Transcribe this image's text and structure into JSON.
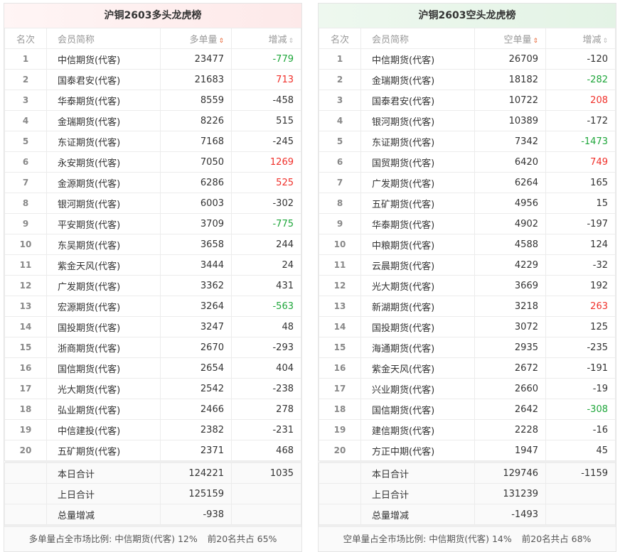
{
  "panels": [
    {
      "key": "long",
      "title": "沪铜2603多头龙虎榜",
      "headers": {
        "rank": "名次",
        "name": "会员简称",
        "volume": "多单量",
        "change": "增减"
      },
      "rows": [
        [
          "1",
          "中信期货(代客)",
          "23477",
          "-779",
          "green"
        ],
        [
          "2",
          "国泰君安(代客)",
          "21683",
          "713",
          "red"
        ],
        [
          "3",
          "华泰期货(代客)",
          "8559",
          "-458",
          ""
        ],
        [
          "4",
          "金瑞期货(代客)",
          "8226",
          "515",
          ""
        ],
        [
          "5",
          "东证期货(代客)",
          "7168",
          "-245",
          ""
        ],
        [
          "6",
          "永安期货(代客)",
          "7050",
          "1269",
          "red"
        ],
        [
          "7",
          "金源期货(代客)",
          "6286",
          "525",
          "red"
        ],
        [
          "8",
          "银河期货(代客)",
          "6003",
          "-302",
          ""
        ],
        [
          "9",
          "平安期货(代客)",
          "3709",
          "-775",
          "green"
        ],
        [
          "10",
          "东吴期货(代客)",
          "3658",
          "244",
          ""
        ],
        [
          "11",
          "紫金天风(代客)",
          "3444",
          "24",
          ""
        ],
        [
          "12",
          "广发期货(代客)",
          "3362",
          "431",
          ""
        ],
        [
          "13",
          "宏源期货(代客)",
          "3264",
          "-563",
          "green"
        ],
        [
          "14",
          "国投期货(代客)",
          "3247",
          "48",
          ""
        ],
        [
          "15",
          "浙商期货(代客)",
          "2670",
          "-293",
          ""
        ],
        [
          "16",
          "国信期货(代客)",
          "2654",
          "404",
          ""
        ],
        [
          "17",
          "光大期货(代客)",
          "2542",
          "-238",
          ""
        ],
        [
          "18",
          "弘业期货(代客)",
          "2466",
          "278",
          ""
        ],
        [
          "19",
          "中信建投(代客)",
          "2382",
          "-231",
          ""
        ],
        [
          "20",
          "五矿期货(代客)",
          "2371",
          "468",
          ""
        ]
      ],
      "totals": [
        [
          "本日合计",
          "124221",
          "1035"
        ],
        [
          "上日合计",
          "125159",
          ""
        ],
        [
          "总量增减",
          "-938",
          ""
        ]
      ],
      "footer": {
        "ratio": "多单量占全市场比例: 中信期货(代客) 12%",
        "top20": "前20名共占 65%"
      }
    },
    {
      "key": "short",
      "title": "沪铜2603空头龙虎榜",
      "headers": {
        "rank": "名次",
        "name": "会员简称",
        "volume": "空单量",
        "change": "增减"
      },
      "rows": [
        [
          "1",
          "中信期货(代客)",
          "26709",
          "-120",
          ""
        ],
        [
          "2",
          "金瑞期货(代客)",
          "18182",
          "-282",
          "green"
        ],
        [
          "3",
          "国泰君安(代客)",
          "10722",
          "208",
          "red"
        ],
        [
          "4",
          "银河期货(代客)",
          "10389",
          "-172",
          ""
        ],
        [
          "5",
          "东证期货(代客)",
          "7342",
          "-1473",
          "green"
        ],
        [
          "6",
          "国贸期货(代客)",
          "6420",
          "749",
          "red"
        ],
        [
          "7",
          "广发期货(代客)",
          "6264",
          "165",
          ""
        ],
        [
          "8",
          "五矿期货(代客)",
          "4956",
          "15",
          ""
        ],
        [
          "9",
          "华泰期货(代客)",
          "4902",
          "-197",
          ""
        ],
        [
          "10",
          "中粮期货(代客)",
          "4588",
          "124",
          ""
        ],
        [
          "11",
          "云晨期货(代客)",
          "4229",
          "-32",
          ""
        ],
        [
          "12",
          "光大期货(代客)",
          "3669",
          "192",
          ""
        ],
        [
          "13",
          "新湖期货(代客)",
          "3218",
          "263",
          "red"
        ],
        [
          "14",
          "国投期货(代客)",
          "3072",
          "125",
          ""
        ],
        [
          "15",
          "海通期货(代客)",
          "2935",
          "-235",
          ""
        ],
        [
          "16",
          "紫金天风(代客)",
          "2672",
          "-191",
          ""
        ],
        [
          "17",
          "兴业期货(代客)",
          "2660",
          "-19",
          ""
        ],
        [
          "18",
          "国信期货(代客)",
          "2642",
          "-308",
          "green"
        ],
        [
          "19",
          "建信期货(代客)",
          "2228",
          "-16",
          ""
        ],
        [
          "20",
          "方正中期(代客)",
          "1947",
          "45",
          ""
        ]
      ],
      "totals": [
        [
          "本日合计",
          "129746",
          "-1159"
        ],
        [
          "上日合计",
          "131239",
          ""
        ],
        [
          "总量增减",
          "-1493",
          ""
        ]
      ],
      "footer": {
        "ratio": "空单量占全市场比例: 中信期货(代客) 14%",
        "top20": "前20名共占 68%"
      }
    }
  ],
  "colors": {
    "green": "#1ea63a",
    "red": "#f0302a"
  },
  "icons": {
    "sort": "sort-caret-icon"
  }
}
